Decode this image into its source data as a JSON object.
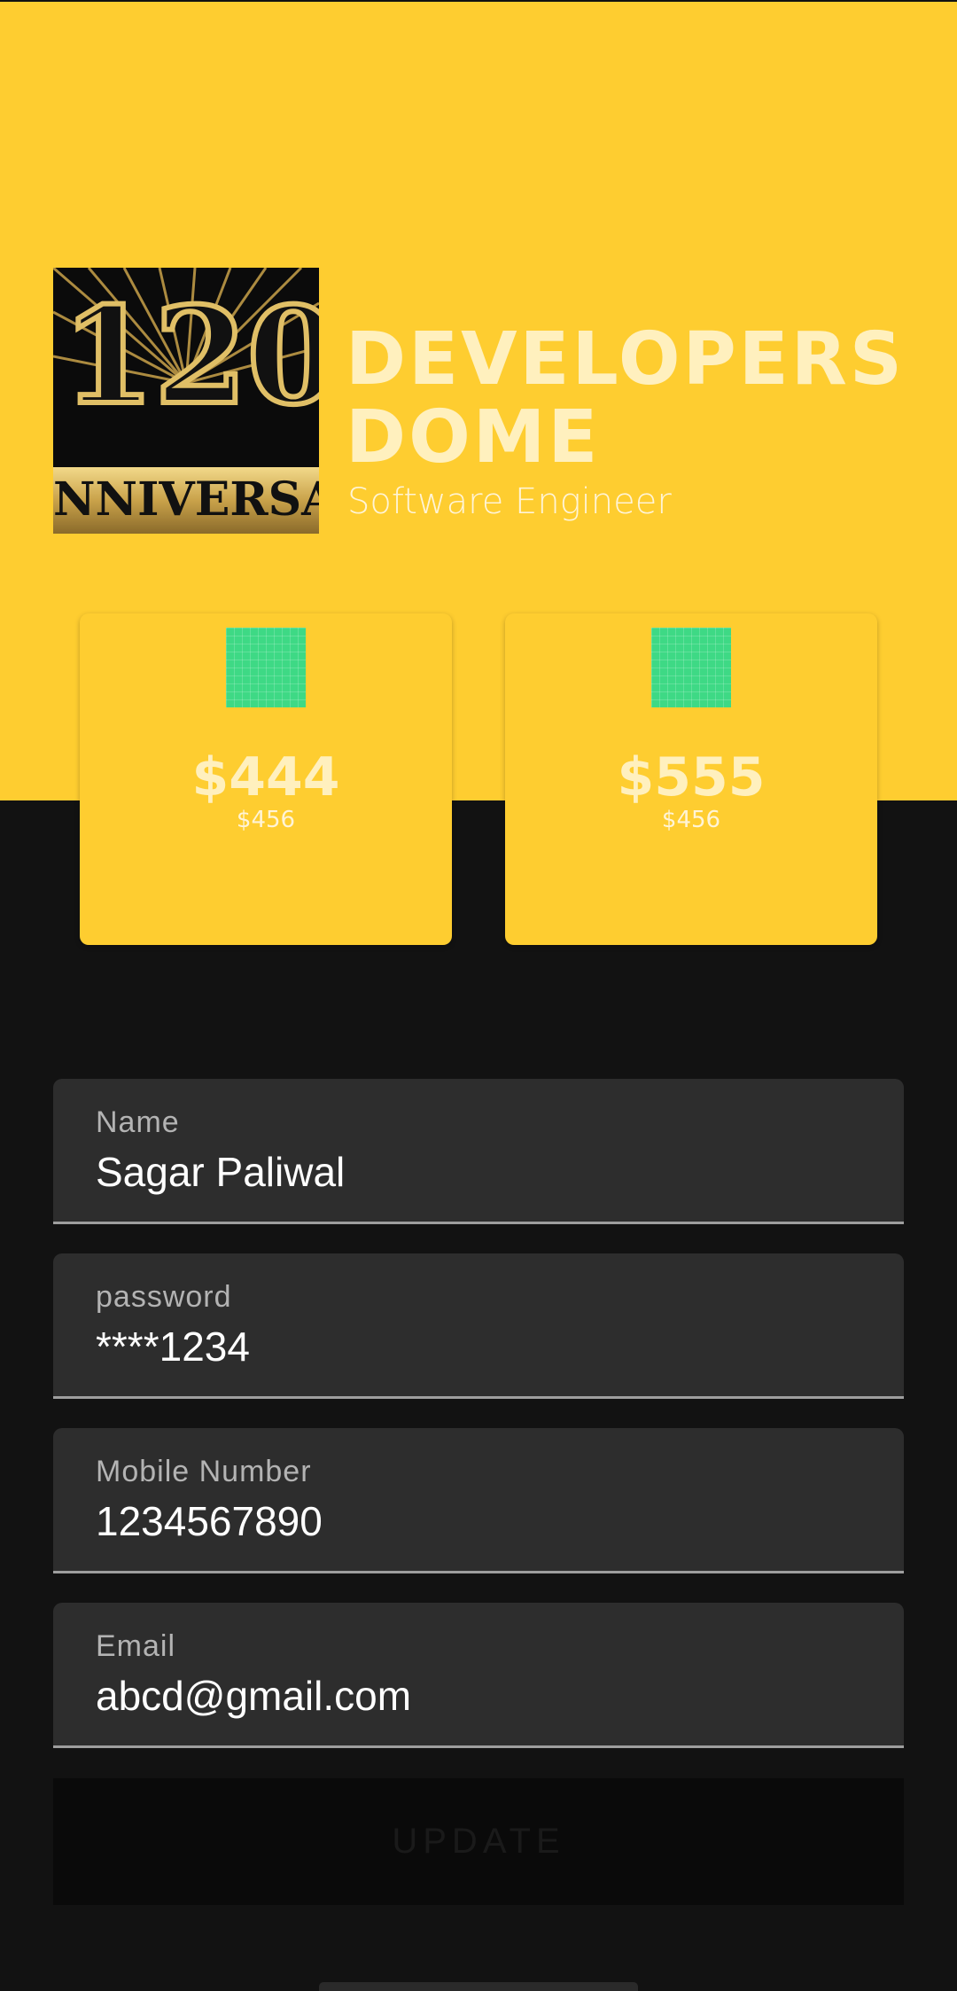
{
  "header": {
    "logo": {
      "alt": "120th Anniversary logo",
      "number": "120",
      "text": "NNIVERSAR"
    },
    "title": "DEVELOPERS DOME",
    "subtitle": "Software Engineer"
  },
  "cards": [
    {
      "value": "$444",
      "subvalue": "$456",
      "thumb_color": "#3ED985"
    },
    {
      "value": "$555",
      "subvalue": "$456",
      "thumb_color": "#3ED985"
    }
  ],
  "form": {
    "fields": [
      {
        "label": "Name",
        "value": "Sagar Paliwal"
      },
      {
        "label": "password",
        "value": "****1234"
      },
      {
        "label": "Mobile Number",
        "value": "1234567890"
      },
      {
        "label": "Email",
        "value": "abcd@gmail.com"
      }
    ],
    "update_label": "UPDATE"
  },
  "colors": {
    "header_bg": "#FECD30",
    "page_bg": "#121212",
    "field_bg": "#2D2D2D",
    "accent_green": "#3ED985"
  }
}
